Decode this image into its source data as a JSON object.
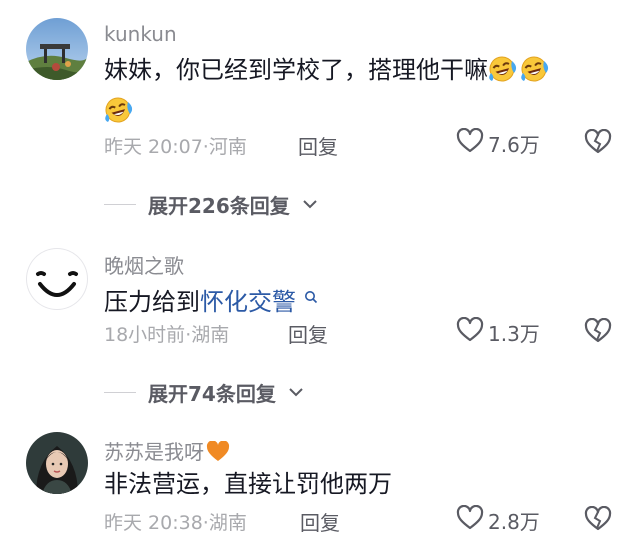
{
  "comments": [
    {
      "username": "kunkun",
      "text": "妹妹，你已经到学校了，搭理他干嘛",
      "time": "昨天 20:07",
      "location": "河南",
      "reply_label": "回复",
      "likes": "7.6万",
      "emojis": [
        "face-with-tears-of-joy",
        "face-with-tears-of-joy",
        "face-with-tears-of-joy"
      ],
      "expand_label": "展开226条回复"
    },
    {
      "username": "晚烟之歌",
      "text_before": "压力给到",
      "link_text": "怀化交警",
      "time": "18小时前",
      "location": "湖南",
      "reply_label": "回复",
      "likes": "1.3万",
      "expand_label": "展开74条回复"
    },
    {
      "username": "苏苏是我呀",
      "text": "非法营运，直接让罚他两万",
      "time": "昨天 20:38",
      "location": "湖南",
      "reply_label": "回复",
      "likes": "2.8万",
      "username_emoji": "orange-heart"
    }
  ],
  "separator": "·",
  "colors": {
    "username": "#8a8b91",
    "text": "#161823",
    "meta": "#a8a9ad",
    "link": "#2c5aa6",
    "heart": "#f08a24"
  }
}
